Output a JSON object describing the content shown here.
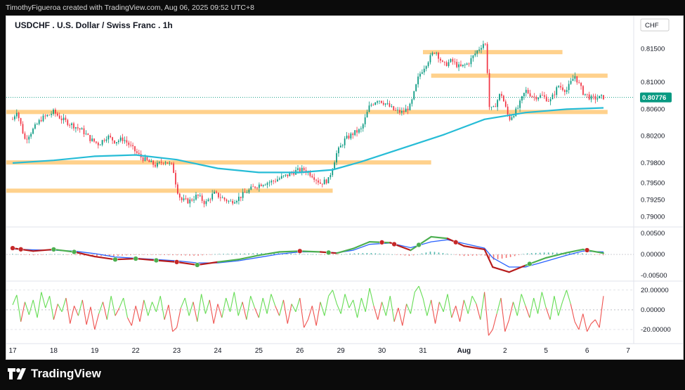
{
  "header": {
    "credit": "TimothyFigueroa created with TradingView.com, Aug 06, 2025 09:52 UTC+8"
  },
  "footer": {
    "logo_text": "TradingView"
  },
  "chart_data": {
    "type": "candlestick",
    "title": "USDCHF . U.S. Dollar / Swiss Franc . 1h",
    "currency_label": "CHF",
    "last_price_label": "0.80776",
    "last_price": 0.80776,
    "price_ticks": [
      "0.81500",
      "0.81000",
      "0.80600",
      "0.80200",
      "0.79800",
      "0.79500",
      "0.79250",
      "0.79000"
    ],
    "price_tick_values": [
      0.815,
      0.81,
      0.806,
      0.802,
      0.798,
      0.795,
      0.7925,
      0.79
    ],
    "macd_ticks": [
      "0.00500",
      "0.00000",
      "-0.00500"
    ],
    "macd_tick_values": [
      0.005,
      0.0,
      -0.005
    ],
    "osc_ticks": [
      "20.00000",
      "0.00000",
      "-20.00000"
    ],
    "osc_tick_values": [
      20,
      0,
      -20
    ],
    "x_labels": [
      "17",
      "18",
      "19",
      "22",
      "23",
      "24",
      "25",
      "26",
      "29",
      "30",
      "31",
      "Aug",
      "2",
      "5",
      "6",
      "7"
    ],
    "x_label_index": [
      0,
      1,
      2,
      3,
      4,
      5,
      6,
      7,
      8,
      9,
      10,
      11,
      12,
      13,
      14,
      15
    ],
    "x_bold": [
      false,
      false,
      false,
      false,
      false,
      false,
      false,
      false,
      false,
      false,
      false,
      true,
      false,
      false,
      false,
      false
    ],
    "zones": [
      {
        "x0": 10.0,
        "x1": 13.4,
        "price_lo": 0.8142,
        "price_hi": 0.8148
      },
      {
        "x0": 10.2,
        "x1": 14.5,
        "price_lo": 0.8107,
        "price_hi": 0.8113
      },
      {
        "x0": -0.2,
        "x1": 14.5,
        "price_lo": 0.8053,
        "price_hi": 0.8059
      },
      {
        "x0": -0.2,
        "x1": 10.2,
        "price_lo": 0.7978,
        "price_hi": 0.7984
      },
      {
        "x0": -0.2,
        "x1": 7.8,
        "price_lo": 0.7936,
        "price_hi": 0.7942
      }
    ],
    "close_path": [
      [
        0.0,
        0.8045
      ],
      [
        0.1,
        0.8058
      ],
      [
        0.3,
        0.8015
      ],
      [
        0.5,
        0.803
      ],
      [
        0.7,
        0.8046
      ],
      [
        0.9,
        0.8052
      ],
      [
        1.0,
        0.8056
      ],
      [
        1.2,
        0.8045
      ],
      [
        1.5,
        0.8035
      ],
      [
        1.7,
        0.8028
      ],
      [
        1.9,
        0.8015
      ],
      [
        2.1,
        0.8008
      ],
      [
        2.3,
        0.802
      ],
      [
        2.5,
        0.8012
      ],
      [
        2.7,
        0.8016
      ],
      [
        2.9,
        0.8003
      ],
      [
        3.1,
        0.799
      ],
      [
        3.3,
        0.7982
      ],
      [
        3.5,
        0.7976
      ],
      [
        3.7,
        0.7984
      ],
      [
        3.9,
        0.7975
      ],
      [
        4.0,
        0.7942
      ],
      [
        4.1,
        0.7925
      ],
      [
        4.3,
        0.7923
      ],
      [
        4.5,
        0.7932
      ],
      [
        4.7,
        0.792
      ],
      [
        4.9,
        0.7935
      ],
      [
        5.1,
        0.7928
      ],
      [
        5.3,
        0.7922
      ],
      [
        5.5,
        0.7928
      ],
      [
        5.7,
        0.7937
      ],
      [
        5.9,
        0.7945
      ],
      [
        6.1,
        0.795
      ],
      [
        6.3,
        0.7952
      ],
      [
        6.5,
        0.7957
      ],
      [
        6.7,
        0.7962
      ],
      [
        6.9,
        0.7968
      ],
      [
        7.1,
        0.797
      ],
      [
        7.3,
        0.7962
      ],
      [
        7.5,
        0.795
      ],
      [
        7.7,
        0.7955
      ],
      [
        7.9,
        0.7995
      ],
      [
        8.1,
        0.8015
      ],
      [
        8.3,
        0.8024
      ],
      [
        8.5,
        0.803
      ],
      [
        8.7,
        0.8065
      ],
      [
        8.9,
        0.8075
      ],
      [
        9.1,
        0.8068
      ],
      [
        9.3,
        0.8058
      ],
      [
        9.5,
        0.8055
      ],
      [
        9.7,
        0.8065
      ],
      [
        9.9,
        0.811
      ],
      [
        10.1,
        0.813
      ],
      [
        10.3,
        0.8148
      ],
      [
        10.5,
        0.8125
      ],
      [
        10.7,
        0.8132
      ],
      [
        10.9,
        0.8122
      ],
      [
        11.1,
        0.8128
      ],
      [
        11.3,
        0.8145
      ],
      [
        11.5,
        0.816
      ],
      [
        11.55,
        0.815
      ],
      [
        11.6,
        0.8065
      ],
      [
        11.7,
        0.8058
      ],
      [
        11.9,
        0.8085
      ],
      [
        12.1,
        0.8045
      ],
      [
        12.3,
        0.806
      ],
      [
        12.5,
        0.8088
      ],
      [
        12.7,
        0.8078
      ],
      [
        12.9,
        0.808
      ],
      [
        13.1,
        0.8072
      ],
      [
        13.3,
        0.8095
      ],
      [
        13.5,
        0.8088
      ],
      [
        13.7,
        0.811
      ],
      [
        13.9,
        0.8085
      ],
      [
        14.1,
        0.8076
      ],
      [
        14.3,
        0.8077
      ],
      [
        14.4,
        0.8078
      ]
    ],
    "ma_path": [
      [
        0.0,
        0.798
      ],
      [
        1.0,
        0.7984
      ],
      [
        2.0,
        0.799
      ],
      [
        3.0,
        0.7992
      ],
      [
        4.0,
        0.7985
      ],
      [
        5.0,
        0.7972
      ],
      [
        6.0,
        0.7966
      ],
      [
        7.0,
        0.7966
      ],
      [
        7.8,
        0.797
      ],
      [
        8.5,
        0.7982
      ],
      [
        9.5,
        0.8002
      ],
      [
        10.5,
        0.8022
      ],
      [
        11.5,
        0.8045
      ],
      [
        12.5,
        0.8055
      ],
      [
        13.5,
        0.806
      ],
      [
        14.4,
        0.8062
      ]
    ],
    "macd_line_path": [
      [
        0.0,
        0.0015
      ],
      [
        0.5,
        0.0008
      ],
      [
        1.0,
        0.0012
      ],
      [
        1.5,
        0.0006
      ],
      [
        2.0,
        -0.0005
      ],
      [
        2.5,
        -0.0012
      ],
      [
        3.0,
        -0.001
      ],
      [
        3.5,
        -0.0014
      ],
      [
        4.0,
        -0.0018
      ],
      [
        4.5,
        -0.0025
      ],
      [
        5.0,
        -0.0018
      ],
      [
        5.5,
        -0.0012
      ],
      [
        6.0,
        -0.0002
      ],
      [
        6.5,
        0.0006
      ],
      [
        7.0,
        0.0008
      ],
      [
        7.5,
        0.0006
      ],
      [
        7.9,
        0.0003
      ],
      [
        8.3,
        0.0014
      ],
      [
        8.7,
        0.003
      ],
      [
        9.2,
        0.0028
      ],
      [
        9.7,
        0.001
      ],
      [
        10.2,
        0.0042
      ],
      [
        10.6,
        0.0038
      ],
      [
        11.0,
        0.002
      ],
      [
        11.5,
        0.0012
      ],
      [
        11.7,
        -0.003
      ],
      [
        12.1,
        -0.0042
      ],
      [
        12.5,
        -0.0026
      ],
      [
        13.0,
        -0.0008
      ],
      [
        13.5,
        0.0004
      ],
      [
        13.9,
        0.0012
      ],
      [
        14.4,
        0.0003
      ]
    ],
    "signal_line_path": [
      [
        0.0,
        0.0013
      ],
      [
        0.5,
        0.0011
      ],
      [
        1.0,
        0.001
      ],
      [
        1.5,
        0.0008
      ],
      [
        2.0,
        0.0002
      ],
      [
        2.5,
        -0.0006
      ],
      [
        3.0,
        -0.0009
      ],
      [
        3.5,
        -0.0012
      ],
      [
        4.0,
        -0.0015
      ],
      [
        4.5,
        -0.002
      ],
      [
        5.0,
        -0.002
      ],
      [
        5.5,
        -0.0015
      ],
      [
        6.0,
        -0.0007
      ],
      [
        6.5,
        0.0001
      ],
      [
        7.0,
        0.0006
      ],
      [
        7.5,
        0.0006
      ],
      [
        7.9,
        0.0004
      ],
      [
        8.3,
        0.001
      ],
      [
        8.7,
        0.0024
      ],
      [
        9.2,
        0.0027
      ],
      [
        9.7,
        0.0016
      ],
      [
        10.2,
        0.003
      ],
      [
        10.6,
        0.0035
      ],
      [
        11.0,
        0.0026
      ],
      [
        11.5,
        0.0015
      ],
      [
        11.7,
        -0.0008
      ],
      [
        12.1,
        -0.003
      ],
      [
        12.5,
        -0.003
      ],
      [
        13.0,
        -0.0016
      ],
      [
        13.5,
        -0.0002
      ],
      [
        13.9,
        0.0008
      ],
      [
        14.4,
        0.0006
      ]
    ],
    "macd_crosses": [
      {
        "x": 0.0,
        "kind": "bear"
      },
      {
        "x": 0.2,
        "kind": "bear"
      },
      {
        "x": 1.0,
        "kind": "bull"
      },
      {
        "x": 1.5,
        "kind": "bull"
      },
      {
        "x": 2.5,
        "kind": "bull"
      },
      {
        "x": 3.0,
        "kind": "bull"
      },
      {
        "x": 3.5,
        "kind": "bull"
      },
      {
        "x": 4.0,
        "kind": "bear"
      },
      {
        "x": 4.5,
        "kind": "bull"
      },
      {
        "x": 7.0,
        "kind": "bear"
      },
      {
        "x": 7.7,
        "kind": "bull"
      },
      {
        "x": 9.0,
        "kind": "bear"
      },
      {
        "x": 9.3,
        "kind": "bear"
      },
      {
        "x": 9.9,
        "kind": "bull"
      },
      {
        "x": 10.8,
        "kind": "bear"
      },
      {
        "x": 12.6,
        "kind": "bull"
      },
      {
        "x": 14.0,
        "kind": "bear"
      }
    ],
    "osc_path": [
      [
        0.0,
        5
      ],
      [
        0.1,
        15
      ],
      [
        0.2,
        -12
      ],
      [
        0.3,
        8
      ],
      [
        0.4,
        -5
      ],
      [
        0.5,
        10
      ],
      [
        0.6,
        -8
      ],
      [
        0.7,
        18
      ],
      [
        0.8,
        2
      ],
      [
        0.9,
        14
      ],
      [
        1.0,
        -10
      ],
      [
        1.1,
        6
      ],
      [
        1.2,
        -2
      ],
      [
        1.3,
        12
      ],
      [
        1.4,
        -14
      ],
      [
        1.5,
        4
      ],
      [
        1.6,
        -6
      ],
      [
        1.7,
        10
      ],
      [
        1.8,
        -15
      ],
      [
        1.9,
        3
      ],
      [
        2.0,
        -20
      ],
      [
        2.1,
        -4
      ],
      [
        2.2,
        8
      ],
      [
        2.3,
        -10
      ],
      [
        2.4,
        14
      ],
      [
        2.5,
        -6
      ],
      [
        2.6,
        2
      ],
      [
        2.7,
        12
      ],
      [
        2.8,
        -8
      ],
      [
        2.9,
        -16
      ],
      [
        3.0,
        4
      ],
      [
        3.1,
        -12
      ],
      [
        3.2,
        10
      ],
      [
        3.3,
        -6
      ],
      [
        3.4,
        8
      ],
      [
        3.5,
        -2
      ],
      [
        3.6,
        14
      ],
      [
        3.7,
        -10
      ],
      [
        3.8,
        5
      ],
      [
        3.9,
        -22
      ],
      [
        4.0,
        -18
      ],
      [
        4.1,
        2
      ],
      [
        4.2,
        12
      ],
      [
        4.3,
        -6
      ],
      [
        4.4,
        8
      ],
      [
        4.5,
        -12
      ],
      [
        4.6,
        16
      ],
      [
        4.7,
        -4
      ],
      [
        4.8,
        10
      ],
      [
        4.9,
        -14
      ],
      [
        5.0,
        6
      ],
      [
        5.1,
        -8
      ],
      [
        5.2,
        12
      ],
      [
        5.3,
        -2
      ],
      [
        5.4,
        18
      ],
      [
        5.5,
        -6
      ],
      [
        5.6,
        8
      ],
      [
        5.7,
        -10
      ],
      [
        5.8,
        14
      ],
      [
        5.9,
        2
      ],
      [
        6.0,
        -8
      ],
      [
        6.1,
        12
      ],
      [
        6.2,
        -4
      ],
      [
        6.3,
        16
      ],
      [
        6.4,
        4
      ],
      [
        6.5,
        -6
      ],
      [
        6.6,
        10
      ],
      [
        6.7,
        -14
      ],
      [
        6.8,
        6
      ],
      [
        6.9,
        -2
      ],
      [
        7.0,
        12
      ],
      [
        7.1,
        -18
      ],
      [
        7.2,
        -10
      ],
      [
        7.3,
        4
      ],
      [
        7.4,
        -16
      ],
      [
        7.5,
        8
      ],
      [
        7.6,
        -6
      ],
      [
        7.7,
        14
      ],
      [
        7.8,
        20
      ],
      [
        7.9,
        6
      ],
      [
        8.0,
        -4
      ],
      [
        8.1,
        16
      ],
      [
        8.2,
        2
      ],
      [
        8.3,
        10
      ],
      [
        8.4,
        -8
      ],
      [
        8.5,
        12
      ],
      [
        8.6,
        -2
      ],
      [
        8.7,
        22
      ],
      [
        8.8,
        4
      ],
      [
        8.9,
        -10
      ],
      [
        9.0,
        8
      ],
      [
        9.1,
        -6
      ],
      [
        9.2,
        14
      ],
      [
        9.3,
        -12
      ],
      [
        9.4,
        2
      ],
      [
        9.5,
        -16
      ],
      [
        9.6,
        6
      ],
      [
        9.7,
        -4
      ],
      [
        9.8,
        18
      ],
      [
        9.9,
        24
      ],
      [
        10.0,
        12
      ],
      [
        10.1,
        -6
      ],
      [
        10.2,
        10
      ],
      [
        10.3,
        -14
      ],
      [
        10.4,
        8
      ],
      [
        10.5,
        -2
      ],
      [
        10.6,
        16
      ],
      [
        10.7,
        -8
      ],
      [
        10.8,
        4
      ],
      [
        10.9,
        -12
      ],
      [
        11.0,
        10
      ],
      [
        11.1,
        -4
      ],
      [
        11.2,
        14
      ],
      [
        11.3,
        6
      ],
      [
        11.4,
        -10
      ],
      [
        11.5,
        18
      ],
      [
        11.6,
        -26
      ],
      [
        11.7,
        -20
      ],
      [
        11.8,
        -4
      ],
      [
        11.9,
        12
      ],
      [
        12.0,
        -22
      ],
      [
        12.1,
        -10
      ],
      [
        12.2,
        8
      ],
      [
        12.3,
        -6
      ],
      [
        12.4,
        16
      ],
      [
        12.5,
        4
      ],
      [
        12.6,
        -8
      ],
      [
        12.7,
        12
      ],
      [
        12.8,
        -4
      ],
      [
        12.9,
        18
      ],
      [
        13.0,
        2
      ],
      [
        13.1,
        -10
      ],
      [
        13.2,
        14
      ],
      [
        13.3,
        -6
      ],
      [
        13.4,
        8
      ],
      [
        13.5,
        20
      ],
      [
        13.6,
        6
      ],
      [
        13.7,
        -12
      ],
      [
        13.8,
        -20
      ],
      [
        13.9,
        -4
      ],
      [
        14.0,
        -22
      ],
      [
        14.1,
        -14
      ],
      [
        14.2,
        -10
      ],
      [
        14.3,
        -18
      ],
      [
        14.4,
        14
      ]
    ]
  }
}
